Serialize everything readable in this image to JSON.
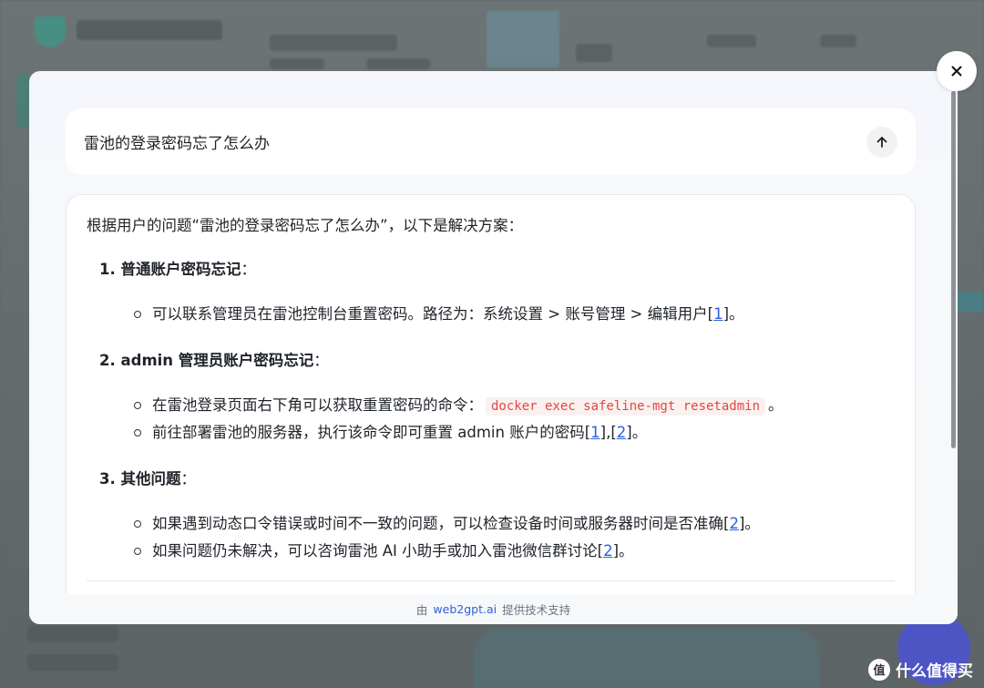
{
  "query": {
    "text": "雷池的登录密码忘了怎么办"
  },
  "answer": {
    "intro": "根据用户的问题“雷池的登录密码忘了怎么办”，以下是解决方案：",
    "sections": [
      {
        "title": "1. 普通账户密码忘记",
        "colon": "：",
        "bullet_1_text": "可以联系管理员在雷池控制台重置密码。路径为：系统设置 > 账号管理 > 编辑用户[",
        "bullet_1_ref": "1",
        "bullet_1_end": "]。"
      },
      {
        "title": "2. admin 管理员账户密码忘记",
        "colon": "：",
        "bullet_1_text": "在雷池登录页面右下角可以获取重置密码的命令：",
        "bullet_1_code": "docker exec safeline-mgt resetadmin",
        "bullet_1_end": "。",
        "bullet_2_text": "前往部署雷池的服务器，执行该命令即可重置 admin 账户的密码[",
        "bullet_2_ref_a": "1",
        "bullet_2_mid": "],[",
        "bullet_2_ref_b": "2",
        "bullet_2_end": "]。"
      },
      {
        "title": "3. 其他问题",
        "colon": "：",
        "bullet_1_text": "如果遇到动态口令错误或时间不一致的问题，可以检查设备时间或服务器时间是否准确[",
        "bullet_1_ref": "2",
        "bullet_1_end": "]。",
        "bullet_2_text": "如果问题仍未解决，可以咨询雷池 AI 小助手或加入雷池微信群讨论[",
        "bullet_2_ref": "2",
        "bullet_2_end": "]。"
      }
    ]
  },
  "footer": {
    "prefix": "由",
    "link": "web2gpt.ai",
    "suffix": "提供技术支持"
  },
  "watermark": {
    "badge": "值",
    "text": "什么值得买"
  },
  "icons": {
    "close": "close-icon",
    "send": "arrow-up-icon"
  },
  "colors": {
    "link": "#2b5fd9",
    "code_text": "#e0483e",
    "code_bg": "#fbf1f1"
  }
}
